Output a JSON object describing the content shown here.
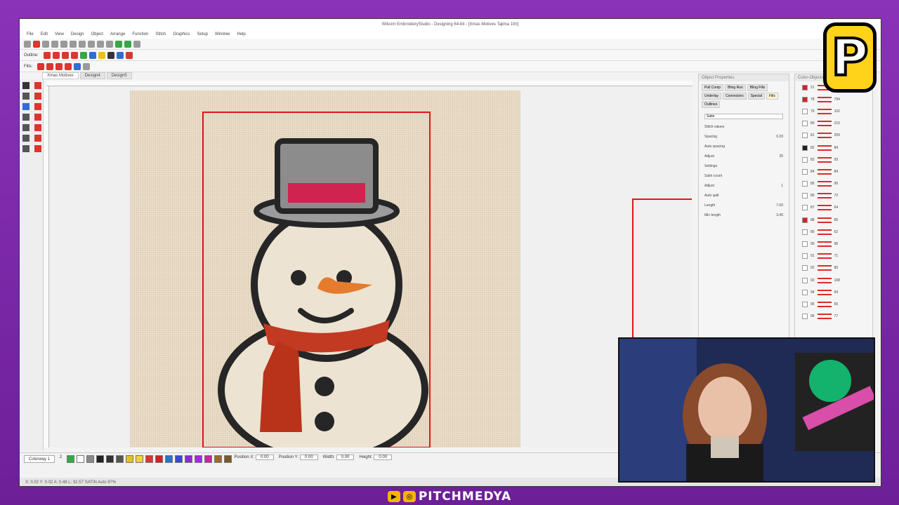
{
  "window": {
    "title": "Wilcom EmbroideryStudio - Designing 64-bit - [Xmas Motives      Tajima 100]"
  },
  "menu": [
    "File",
    "Edit",
    "View",
    "Design",
    "Object",
    "Arrange",
    "Function",
    "Stitch",
    "Graphics",
    "Setup",
    "Window",
    "Help"
  ],
  "toolbar": {
    "outline_label": "Outline:",
    "fills_label": "Fills:"
  },
  "tabs": [
    "Xmas Motives",
    "Design4",
    "Design5"
  ],
  "object_properties": {
    "title": "Object Properties",
    "tabs": [
      "Pull Comp",
      "Bling Run",
      "Bling Fills",
      "Underlay",
      "Connectors",
      "Special",
      "Fills",
      "Outlines"
    ],
    "fill_type": "Satin",
    "rows": [
      {
        "label": "Stitch values",
        "value": ""
      },
      {
        "label": "Spacing",
        "value": "0.20"
      },
      {
        "label": "Auto spacing",
        "value": ""
      },
      {
        "label": "Adjust",
        "value": "25"
      },
      {
        "label": "Settings",
        "value": ""
      },
      {
        "label": "Satin count",
        "value": ""
      },
      {
        "label": "Adjust",
        "value": "1"
      },
      {
        "label": "Auto split",
        "value": ""
      },
      {
        "label": "Length",
        "value": "7.00"
      },
      {
        "label": "Min length",
        "value": "3.40"
      }
    ]
  },
  "color_objects": {
    "title": "Color-Objects",
    "rows": [
      {
        "num": "21",
        "color": "#c62828",
        "stitch": "168"
      },
      {
        "num": "78",
        "color": "#c62828",
        "stitch": "794"
      },
      {
        "num": "79",
        "color": "#ffffff",
        "stitch": "102"
      },
      {
        "num": "80",
        "color": "#ffffff",
        "stitch": "210"
      },
      {
        "num": "81",
        "color": "#ffffff",
        "stitch": "259"
      },
      {
        "num": "82",
        "color": "#222222",
        "stitch": "84"
      },
      {
        "num": "83",
        "color": "#ffffff",
        "stitch": "93"
      },
      {
        "num": "84",
        "color": "#ffffff",
        "stitch": "84"
      },
      {
        "num": "85",
        "color": "#ffffff",
        "stitch": "90"
      },
      {
        "num": "86",
        "color": "#ffffff",
        "stitch": "72"
      },
      {
        "num": "87",
        "color": "#ffffff",
        "stitch": "64"
      },
      {
        "num": "88",
        "color": "#c62828",
        "stitch": "85"
      },
      {
        "num": "89",
        "color": "#ffffff",
        "stitch": "62"
      },
      {
        "num": "90",
        "color": "#ffffff",
        "stitch": "96"
      },
      {
        "num": "91",
        "color": "#ffffff",
        "stitch": "71"
      },
      {
        "num": "92",
        "color": "#ffffff",
        "stitch": "80"
      },
      {
        "num": "93",
        "color": "#ffffff",
        "stitch": "108"
      },
      {
        "num": "94",
        "color": "#ffffff",
        "stitch": "94"
      },
      {
        "num": "95",
        "color": "#ffffff",
        "stitch": "55"
      },
      {
        "num": "96",
        "color": "#ffffff",
        "stitch": "77"
      }
    ]
  },
  "bottom": {
    "colorway": "Colorway 1",
    "thread_count": "2",
    "position_x_label": "Position X:",
    "position_y_label": "Position Y:",
    "width_label": "Width:",
    "height_label": "Height:",
    "position_x": "0.00",
    "position_y": "0.00",
    "width": "0.00",
    "height": "0.00",
    "palette": [
      "#35a845",
      "#ffffff",
      "#888888",
      "#222222",
      "#333333",
      "#555555",
      "#e5c11d",
      "#f0d23a",
      "#d9372f",
      "#c62828",
      "#2e6fd1",
      "#3b4ac9",
      "#8a2bd1",
      "#a52ad6",
      "#c42a9c",
      "#9a6a2a",
      "#7a5a2a"
    ]
  },
  "status": {
    "text": "X: 0.02  Y: 0.02  A: 0.48  L: 92.57    SATIN  Auto 97%"
  },
  "brand": {
    "logo_letter": "P",
    "name": "PITCHMEDYA"
  },
  "colors": {
    "accent_red": "#e2151b",
    "frame_purple": "#7a2aa6",
    "logo_yellow": "#ffd319"
  }
}
